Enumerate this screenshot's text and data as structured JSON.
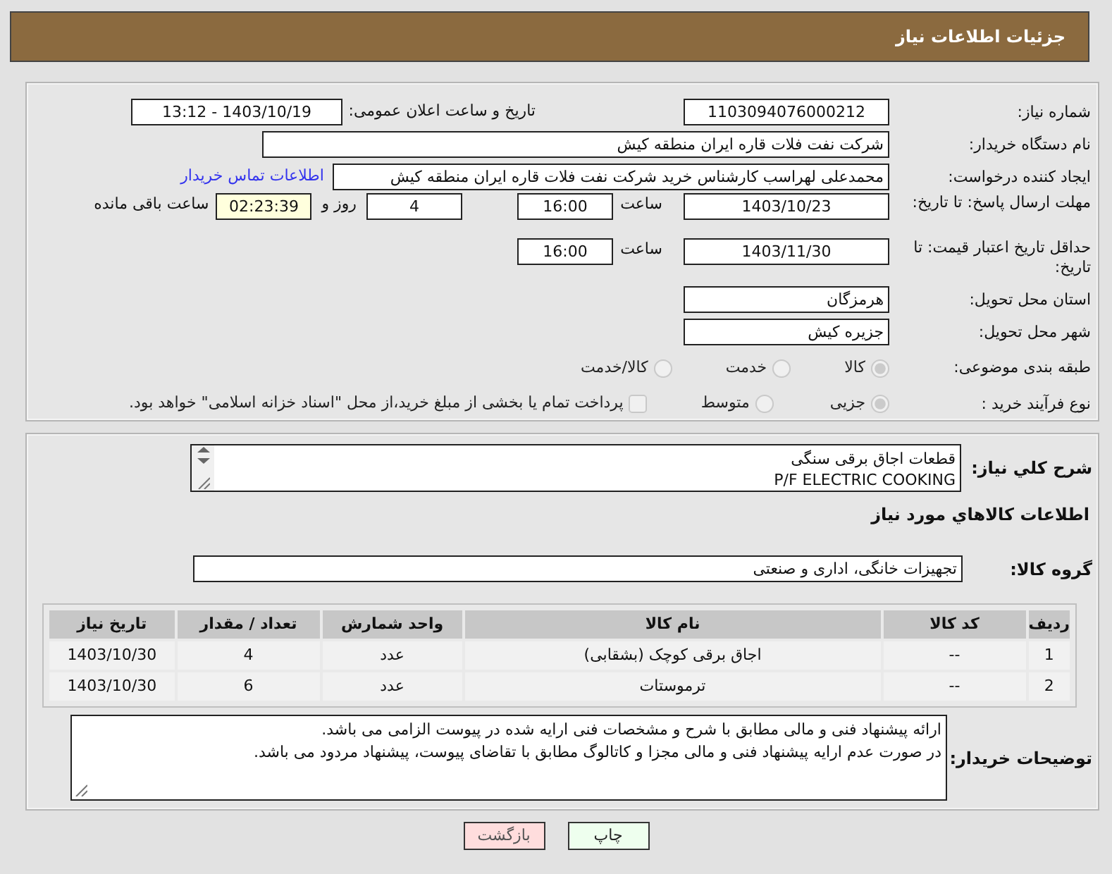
{
  "header": {
    "title": "جزئیات اطلاعات نیاز"
  },
  "need_number": {
    "label": "شماره نیاز:",
    "value": "1103094076000212"
  },
  "announce": {
    "label": "تاریخ و ساعت اعلان عمومی:",
    "value": "1403/10/19 - 13:12"
  },
  "buyer_org": {
    "label": "نام دستگاه خریدار:",
    "value": "شرکت نفت فلات قاره ایران منطقه کیش"
  },
  "requester": {
    "label": "ایجاد کننده درخواست:",
    "value": "محمدعلی لهراسب کارشناس خرید شرکت نفت فلات قاره ایران منطقه کیش",
    "contact_link": "اطلاعات تماس خریدار"
  },
  "reply_deadline": {
    "label": "مهلت ارسال پاسخ: تا تاریخ:",
    "date": "1403/10/23",
    "time_label": "ساعت",
    "time": "16:00",
    "days": "4",
    "days_label": "روز و",
    "remaining": "02:23:39",
    "remaining_label": "ساعت باقی مانده"
  },
  "price_validity": {
    "label": "حداقل تاریخ اعتبار قیمت: تا تاریخ:",
    "date": "1403/11/30",
    "time_label": "ساعت",
    "time": "16:00"
  },
  "province": {
    "label": "استان محل تحویل:",
    "value": "هرمزگان"
  },
  "city": {
    "label": "شهر محل تحویل:",
    "value": "جزیره کیش"
  },
  "category": {
    "label": "طبقه بندی موضوعی:",
    "options": [
      {
        "label": "کالا",
        "selected": true
      },
      {
        "label": "خدمت",
        "selected": false
      },
      {
        "label": "کالا/خدمت",
        "selected": false
      }
    ]
  },
  "process": {
    "label": "نوع فرآیند خرید :",
    "options": [
      {
        "label": "جزیی",
        "selected": true
      },
      {
        "label": "متوسط",
        "selected": false
      }
    ],
    "treasury": {
      "label": "پرداخت تمام یا بخشی از مبلغ خرید،از محل \"اسناد خزانه اسلامی\" خواهد بود.",
      "checked": false
    }
  },
  "description": {
    "label": "شرح کلي نياز:",
    "lines": [
      "قطعات اجاق برقی سنگی",
      "P/F ELECTRIC COOKING"
    ]
  },
  "items_heading": "اطلاعات کالاهاي مورد نياز",
  "goods_group": {
    "label": "گروه کالا:",
    "value": "تجهیزات خانگی، اداری و صنعتی"
  },
  "table": {
    "columns": [
      "رديف",
      "کد کالا",
      "نام کالا",
      "واحد شمارش",
      "تعداد / مقدار",
      "تاریخ نیاز"
    ],
    "rows": [
      [
        "1",
        "--",
        "اجاق برقی کوچک (بشقابی)",
        "عدد",
        "4",
        "1403/10/30"
      ],
      [
        "2",
        "--",
        "ترموستات",
        "عدد",
        "6",
        "1403/10/30"
      ]
    ]
  },
  "buyer_notes": {
    "label": "توضیحات خریدار:",
    "lines": [
      "ارائه پیشنهاد فنی و مالی مطابق با شرح و مشخصات فنی ارایه شده در پیوست الزامی می باشد.",
      "در صورت عدم ارایه پیشنهاد فنی و مالی مجزا و کاتالوگ مطابق با تقاضای پیوست، پیشنهاد مردود می باشد."
    ]
  },
  "buttons": [
    {
      "label": "چاپ",
      "kind": "print"
    },
    {
      "label": "بازگشت",
      "kind": "back"
    }
  ]
}
